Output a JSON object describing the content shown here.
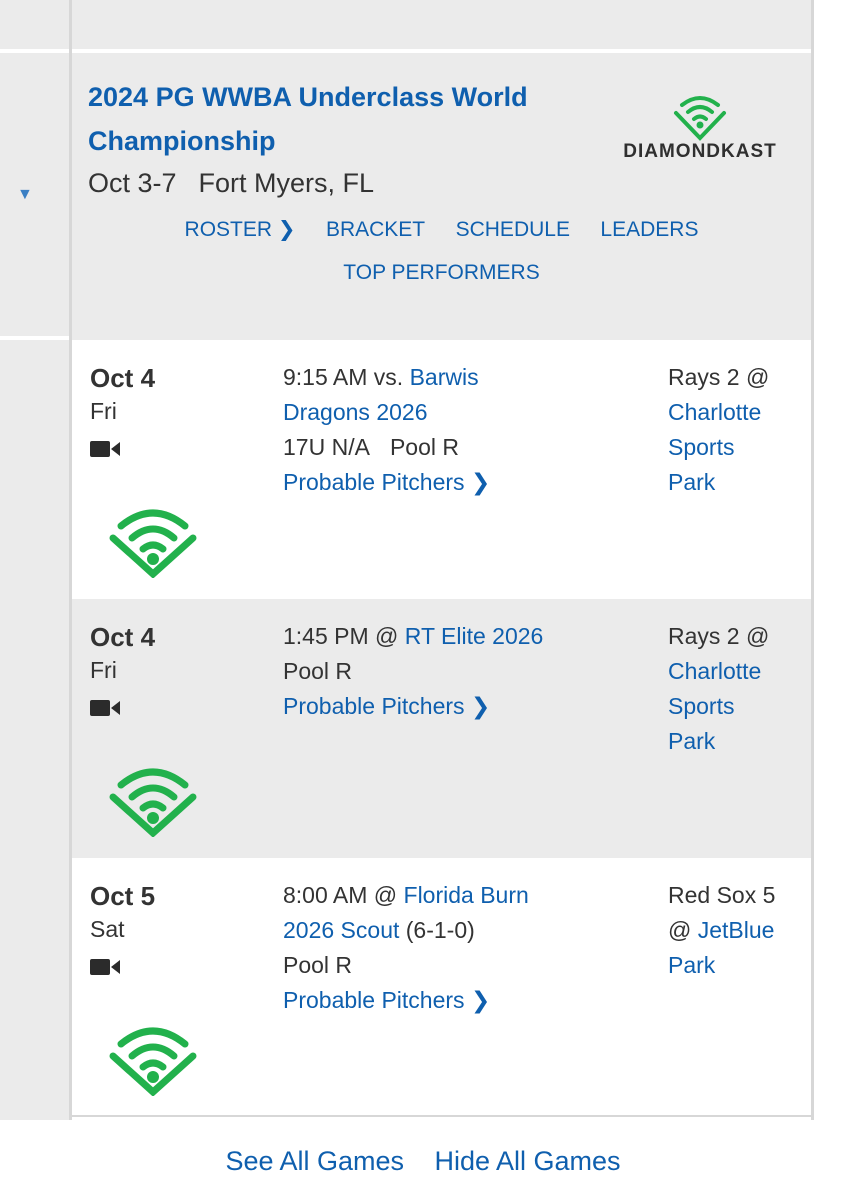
{
  "event": {
    "title": "2024 PG WWBA Underclass World Championship",
    "dates": "Oct 3-7",
    "location": "Fort Myers, FL",
    "brand": "DIAMONDKAST",
    "links": {
      "roster": "ROSTER",
      "bracket": "BRACKET",
      "schedule": "SCHEDULE",
      "leaders": "LEADERS",
      "top_performers": "TOP PERFORMERS"
    }
  },
  "games": [
    {
      "date": "Oct 4",
      "day": "Fri",
      "time_prefix": "9:15 AM vs.",
      "opponent_line1": "Barwis",
      "opponent_line2": "Dragons 2026",
      "division": "17U N/A",
      "pool": "Pool R",
      "probable": "Probable Pitchers",
      "venue_field": "Rays 2 @",
      "venue_name_1": "Charlotte",
      "venue_name_2": "Sports",
      "venue_name_3": "Park"
    },
    {
      "date": "Oct 4",
      "day": "Fri",
      "time_prefix": "1:45 PM @",
      "opponent": "RT Elite 2026",
      "pool": "Pool R",
      "probable": "Probable Pitchers",
      "venue_field": "Rays 2 @",
      "venue_name_1": "Charlotte",
      "venue_name_2": "Sports",
      "venue_name_3": "Park"
    },
    {
      "date": "Oct 5",
      "day": "Sat",
      "time_prefix": "8:00 AM @",
      "opponent_line1": "Florida Burn",
      "opponent_line2": "2026 Scout",
      "record": "(6-1-0)",
      "pool": "Pool R",
      "probable": "Probable Pitchers",
      "venue_field": "Red Sox 5",
      "venue_at": "@",
      "venue_name_1": "JetBlue",
      "venue_name_2": "Park"
    }
  ],
  "footer": {
    "see_all": "See All Games",
    "hide_all": "Hide All Games"
  },
  "colors": {
    "link": "#0f5fae",
    "panel": "#ebebeb",
    "brand_green": "#22b14c"
  }
}
